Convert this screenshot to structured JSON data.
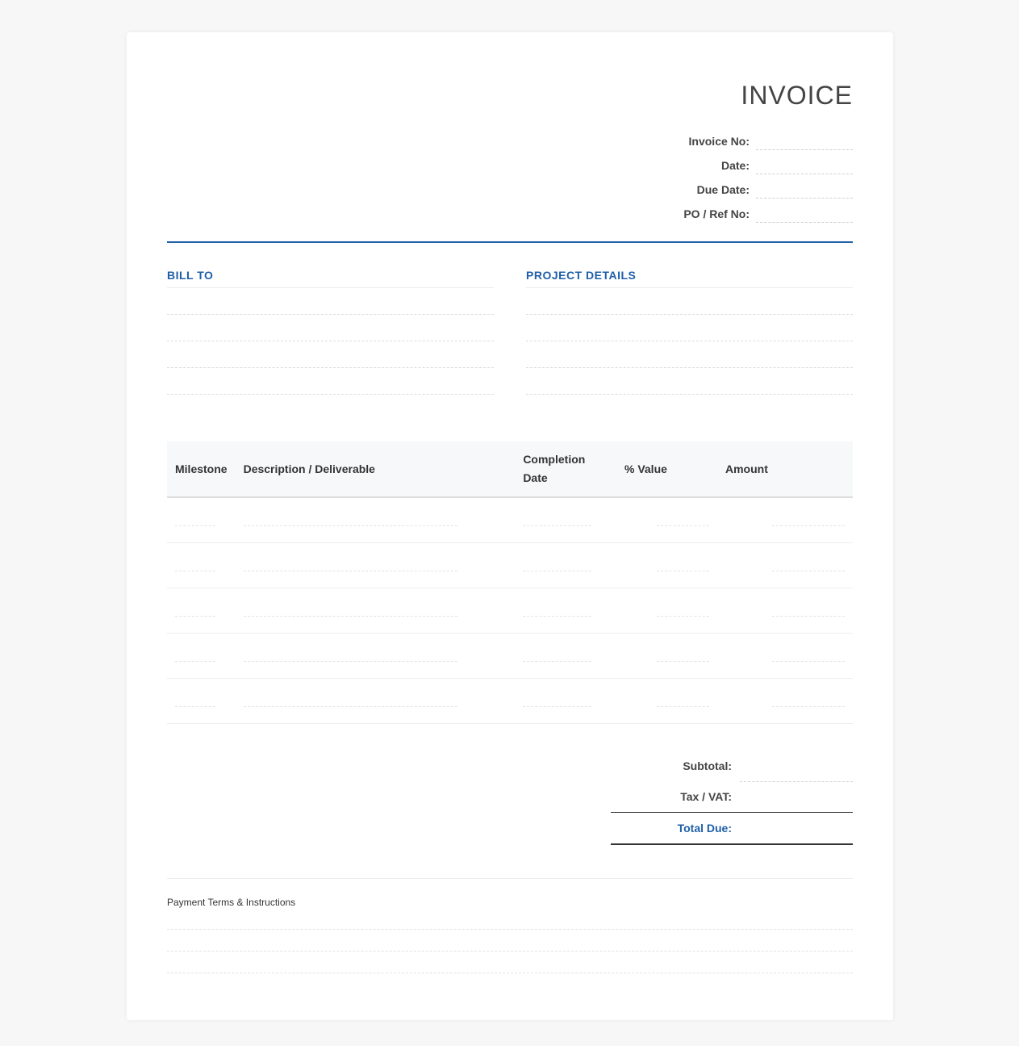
{
  "header": {
    "title": "INVOICE",
    "fields": [
      {
        "label": "Invoice No:",
        "value": ""
      },
      {
        "label": "Date:",
        "value": ""
      },
      {
        "label": "Due Date:",
        "value": ""
      },
      {
        "label": "PO / Ref No:",
        "value": ""
      }
    ]
  },
  "bill_to": {
    "heading": "BILL TO",
    "lines": [
      "",
      "",
      "",
      ""
    ]
  },
  "project_details": {
    "heading": "PROJECT DETAILS",
    "lines": [
      "",
      "",
      "",
      ""
    ]
  },
  "table": {
    "columns": [
      "Milestone",
      "Description / Deliverable",
      "Completion Date",
      "% Value",
      "Amount"
    ],
    "rows": [
      [
        "",
        "",
        "",
        "",
        ""
      ],
      [
        "",
        "",
        "",
        "",
        ""
      ],
      [
        "",
        "",
        "",
        "",
        ""
      ],
      [
        "",
        "",
        "",
        "",
        ""
      ],
      [
        "",
        "",
        "",
        "",
        ""
      ]
    ]
  },
  "totals": {
    "subtotal_label": "Subtotal:",
    "tax_label": "Tax / VAT:",
    "total_label": "Total Due:"
  },
  "terms": {
    "heading": "Payment Terms & Instructions",
    "lines": [
      "",
      "",
      ""
    ]
  },
  "colors": {
    "accent": "#1f5fa8",
    "background": "#f7f7f7"
  }
}
